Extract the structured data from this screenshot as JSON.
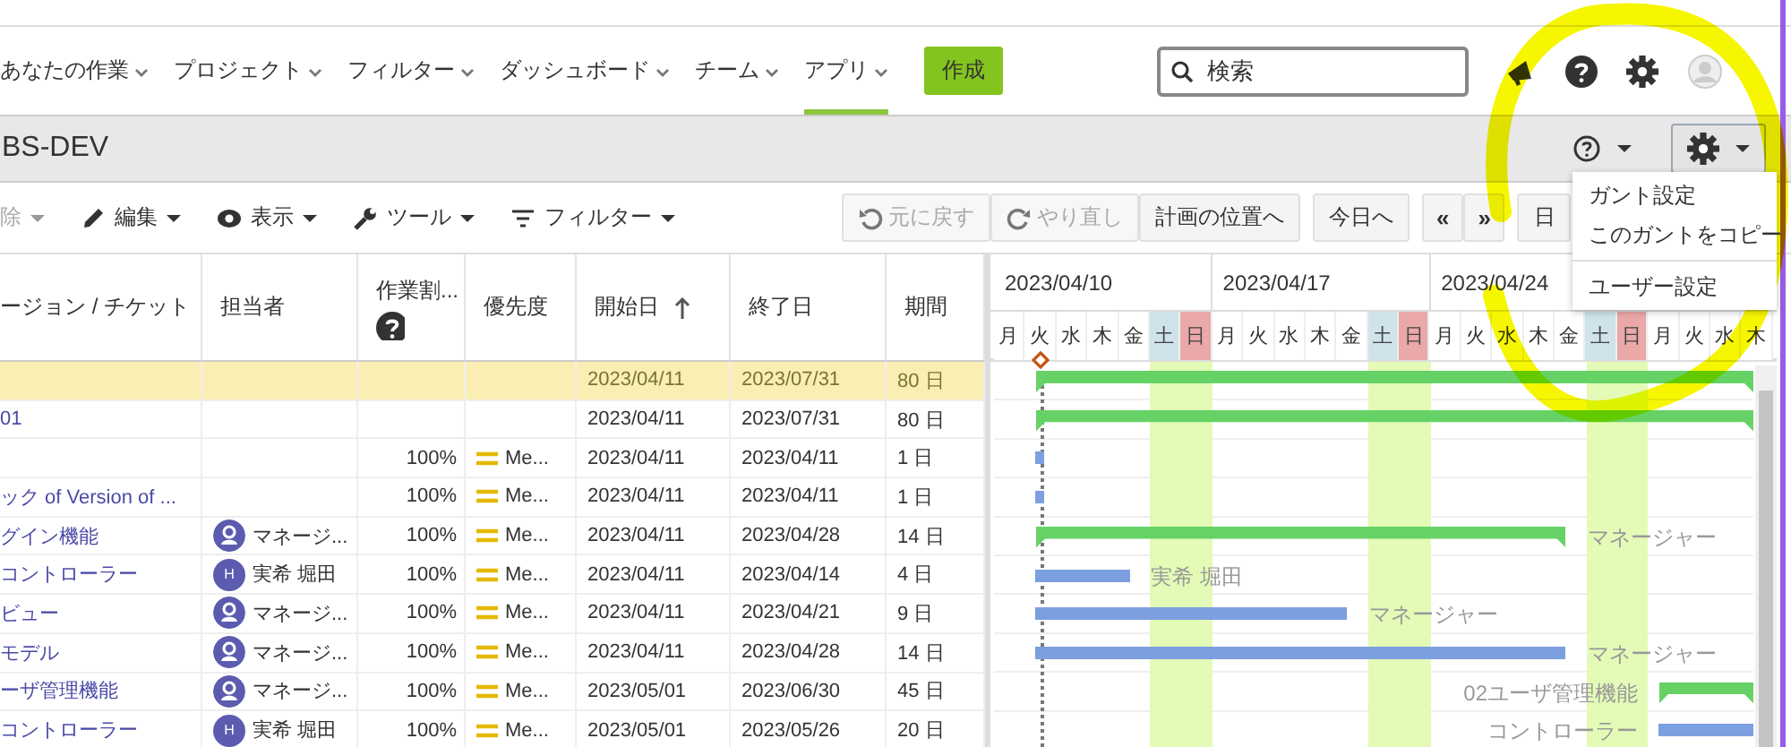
{
  "nav": {
    "items": [
      {
        "label": "あなたの作業",
        "selected": false
      },
      {
        "label": "プロジェクト",
        "selected": false
      },
      {
        "label": "フィルター",
        "selected": false
      },
      {
        "label": "ダッシュボード",
        "selected": false
      },
      {
        "label": "チーム",
        "selected": false
      },
      {
        "label": "アプリ",
        "selected": true
      }
    ],
    "create_button": "作成",
    "search": {
      "placeholder": "検索"
    }
  },
  "project_bar": {
    "title": "BS-DEV",
    "settings_open": true
  },
  "toolbar": {
    "left": [
      {
        "label": "除",
        "kind": "delete",
        "disabled": true
      },
      {
        "label": "編集",
        "kind": "edit",
        "disabled": false
      },
      {
        "label": "表示",
        "kind": "view",
        "disabled": false
      },
      {
        "label": "ツール",
        "kind": "tools",
        "disabled": false
      },
      {
        "label": "フィルター",
        "kind": "filter",
        "disabled": false
      }
    ],
    "right": [
      {
        "label": "元に戻す",
        "kind": "undo",
        "disabled": true
      },
      {
        "label": "やり直し",
        "kind": "redo",
        "disabled": true
      },
      {
        "label": "計画の位置へ",
        "kind": "plain",
        "disabled": false
      },
      {
        "label": "今日へ",
        "kind": "plain",
        "disabled": false
      },
      {
        "label": "«",
        "kind": "prev",
        "disabled": false
      },
      {
        "label": "»",
        "kind": "next",
        "disabled": false
      },
      {
        "label": "日",
        "kind": "scale",
        "disabled": false
      }
    ]
  },
  "table": {
    "columns": [
      {
        "label": "ージョン / チケット"
      },
      {
        "label": "担当者"
      },
      {
        "label": "作業割...",
        "help": true
      },
      {
        "label": "優先度"
      },
      {
        "label": "開始日",
        "sorted": true
      },
      {
        "label": "終了日"
      },
      {
        "label": "期間"
      }
    ],
    "rows": [
      {
        "selected": true,
        "start": "2023/04/11",
        "end": "2023/07/31",
        "duration": "80 日",
        "bar": {
          "kind": "summary"
        }
      },
      {
        "selected": false,
        "ticket": "01",
        "start": "2023/04/11",
        "end": "2023/07/31",
        "duration": "80 日",
        "bar": {
          "kind": "summary"
        }
      },
      {
        "selected": false,
        "progress": "100%",
        "priority": "Me...",
        "start": "2023/04/11",
        "end": "2023/04/11",
        "duration": "1 日",
        "bar": {
          "kind": "task"
        }
      },
      {
        "selected": false,
        "ticket": "ック of Version of ...",
        "progress": "100%",
        "priority": "Me...",
        "start": "2023/04/11",
        "end": "2023/04/11",
        "duration": "1 日",
        "bar": {
          "kind": "task"
        }
      },
      {
        "selected": false,
        "ticket": "グイン機能",
        "assignee": {
          "name": "マネージ...",
          "avatar": {
            "kind": "icon"
          }
        },
        "progress": "100%",
        "priority": "Me...",
        "start": "2023/04/11",
        "end": "2023/04/28",
        "duration": "14 日",
        "bar": {
          "kind": "summary"
        },
        "gantt_label": {
          "text": "マネージャー",
          "kind": "after"
        }
      },
      {
        "selected": false,
        "ticket": "コントローラー",
        "assignee": {
          "name": "実希 堀田",
          "avatar": {
            "kind": "initial",
            "initial": "H"
          }
        },
        "progress": "100%",
        "priority": "Me...",
        "start": "2023/04/11",
        "end": "2023/04/14",
        "duration": "4 日",
        "bar": {
          "kind": "task"
        },
        "gantt_label": {
          "text": "実希 堀田",
          "kind": "after"
        }
      },
      {
        "selected": false,
        "ticket": "ビュー",
        "assignee": {
          "name": "マネージ...",
          "avatar": {
            "kind": "icon"
          }
        },
        "progress": "100%",
        "priority": "Me...",
        "start": "2023/04/11",
        "end": "2023/04/21",
        "duration": "9 日",
        "bar": {
          "kind": "task"
        },
        "gantt_label": {
          "text": "マネージャー",
          "kind": "after"
        }
      },
      {
        "selected": false,
        "ticket": "モデル",
        "assignee": {
          "name": "マネージ...",
          "avatar": {
            "kind": "icon"
          }
        },
        "progress": "100%",
        "priority": "Me...",
        "start": "2023/04/11",
        "end": "2023/04/28",
        "duration": "14 日",
        "bar": {
          "kind": "task"
        },
        "gantt_label": {
          "text": "マネージャー",
          "kind": "after"
        }
      },
      {
        "selected": false,
        "ticket": "ーザ管理機能",
        "assignee": {
          "name": "マネージ...",
          "avatar": {
            "kind": "icon"
          }
        },
        "progress": "100%",
        "priority": "Me...",
        "start": "2023/05/01",
        "end": "2023/06/30",
        "duration": "45 日",
        "bar": {
          "kind": "summary"
        },
        "gantt_label": {
          "text": "02ユーザ管理機能",
          "kind": "before"
        }
      },
      {
        "selected": false,
        "ticket": "コントローラー",
        "assignee": {
          "name": "実希 堀田",
          "avatar": {
            "kind": "initial",
            "initial": "H"
          }
        },
        "progress": "100%",
        "priority": "Me...",
        "start": "2023/05/01",
        "end": "2023/05/26",
        "duration": "20 日",
        "bar": {
          "kind": "task"
        },
        "gantt_label": {
          "text": "コントローラー",
          "kind": "before"
        }
      }
    ]
  },
  "gantt": {
    "weeks": [
      "2023/04/10",
      "2023/04/17",
      "2023/04/24"
    ],
    "days": [
      {
        "label": "月",
        "kind": "weekday",
        "today": false
      },
      {
        "label": "火",
        "kind": "weekday",
        "today": true
      },
      {
        "label": "水",
        "kind": "weekday",
        "today": false
      },
      {
        "label": "木",
        "kind": "weekday",
        "today": false
      },
      {
        "label": "金",
        "kind": "weekday",
        "today": false
      },
      {
        "label": "土",
        "kind": "sat",
        "today": false
      },
      {
        "label": "日",
        "kind": "sun",
        "today": false
      },
      {
        "label": "月",
        "kind": "weekday",
        "today": false
      },
      {
        "label": "火",
        "kind": "weekday",
        "today": false
      },
      {
        "label": "水",
        "kind": "weekday",
        "today": false
      },
      {
        "label": "木",
        "kind": "weekday",
        "today": false
      },
      {
        "label": "金",
        "kind": "weekday",
        "today": false
      },
      {
        "label": "土",
        "kind": "sat",
        "today": false
      },
      {
        "label": "日",
        "kind": "sun",
        "today": false
      },
      {
        "label": "月",
        "kind": "weekday",
        "today": false
      },
      {
        "label": "火",
        "kind": "weekday",
        "today": false
      },
      {
        "label": "水",
        "kind": "weekday",
        "today": false
      },
      {
        "label": "木",
        "kind": "weekday",
        "today": false
      },
      {
        "label": "金",
        "kind": "weekday",
        "today": false
      },
      {
        "label": "土",
        "kind": "sat",
        "today": false
      },
      {
        "label": "日",
        "kind": "sun",
        "today": false
      },
      {
        "label": "月",
        "kind": "weekday",
        "today": false
      },
      {
        "label": "火",
        "kind": "weekday",
        "today": false
      },
      {
        "label": "水",
        "kind": "weekday",
        "today": false
      },
      {
        "label": "木",
        "kind": "weekday",
        "today": false
      }
    ]
  },
  "settings_menu": {
    "items": [
      {
        "label": "ガント設定",
        "divider_before": false
      },
      {
        "label": "このガントをコピー",
        "divider_before": false
      },
      {
        "label": "ユーザー設定",
        "divider_before": true
      }
    ]
  },
  "highlight": {
    "kind": "loop"
  }
}
